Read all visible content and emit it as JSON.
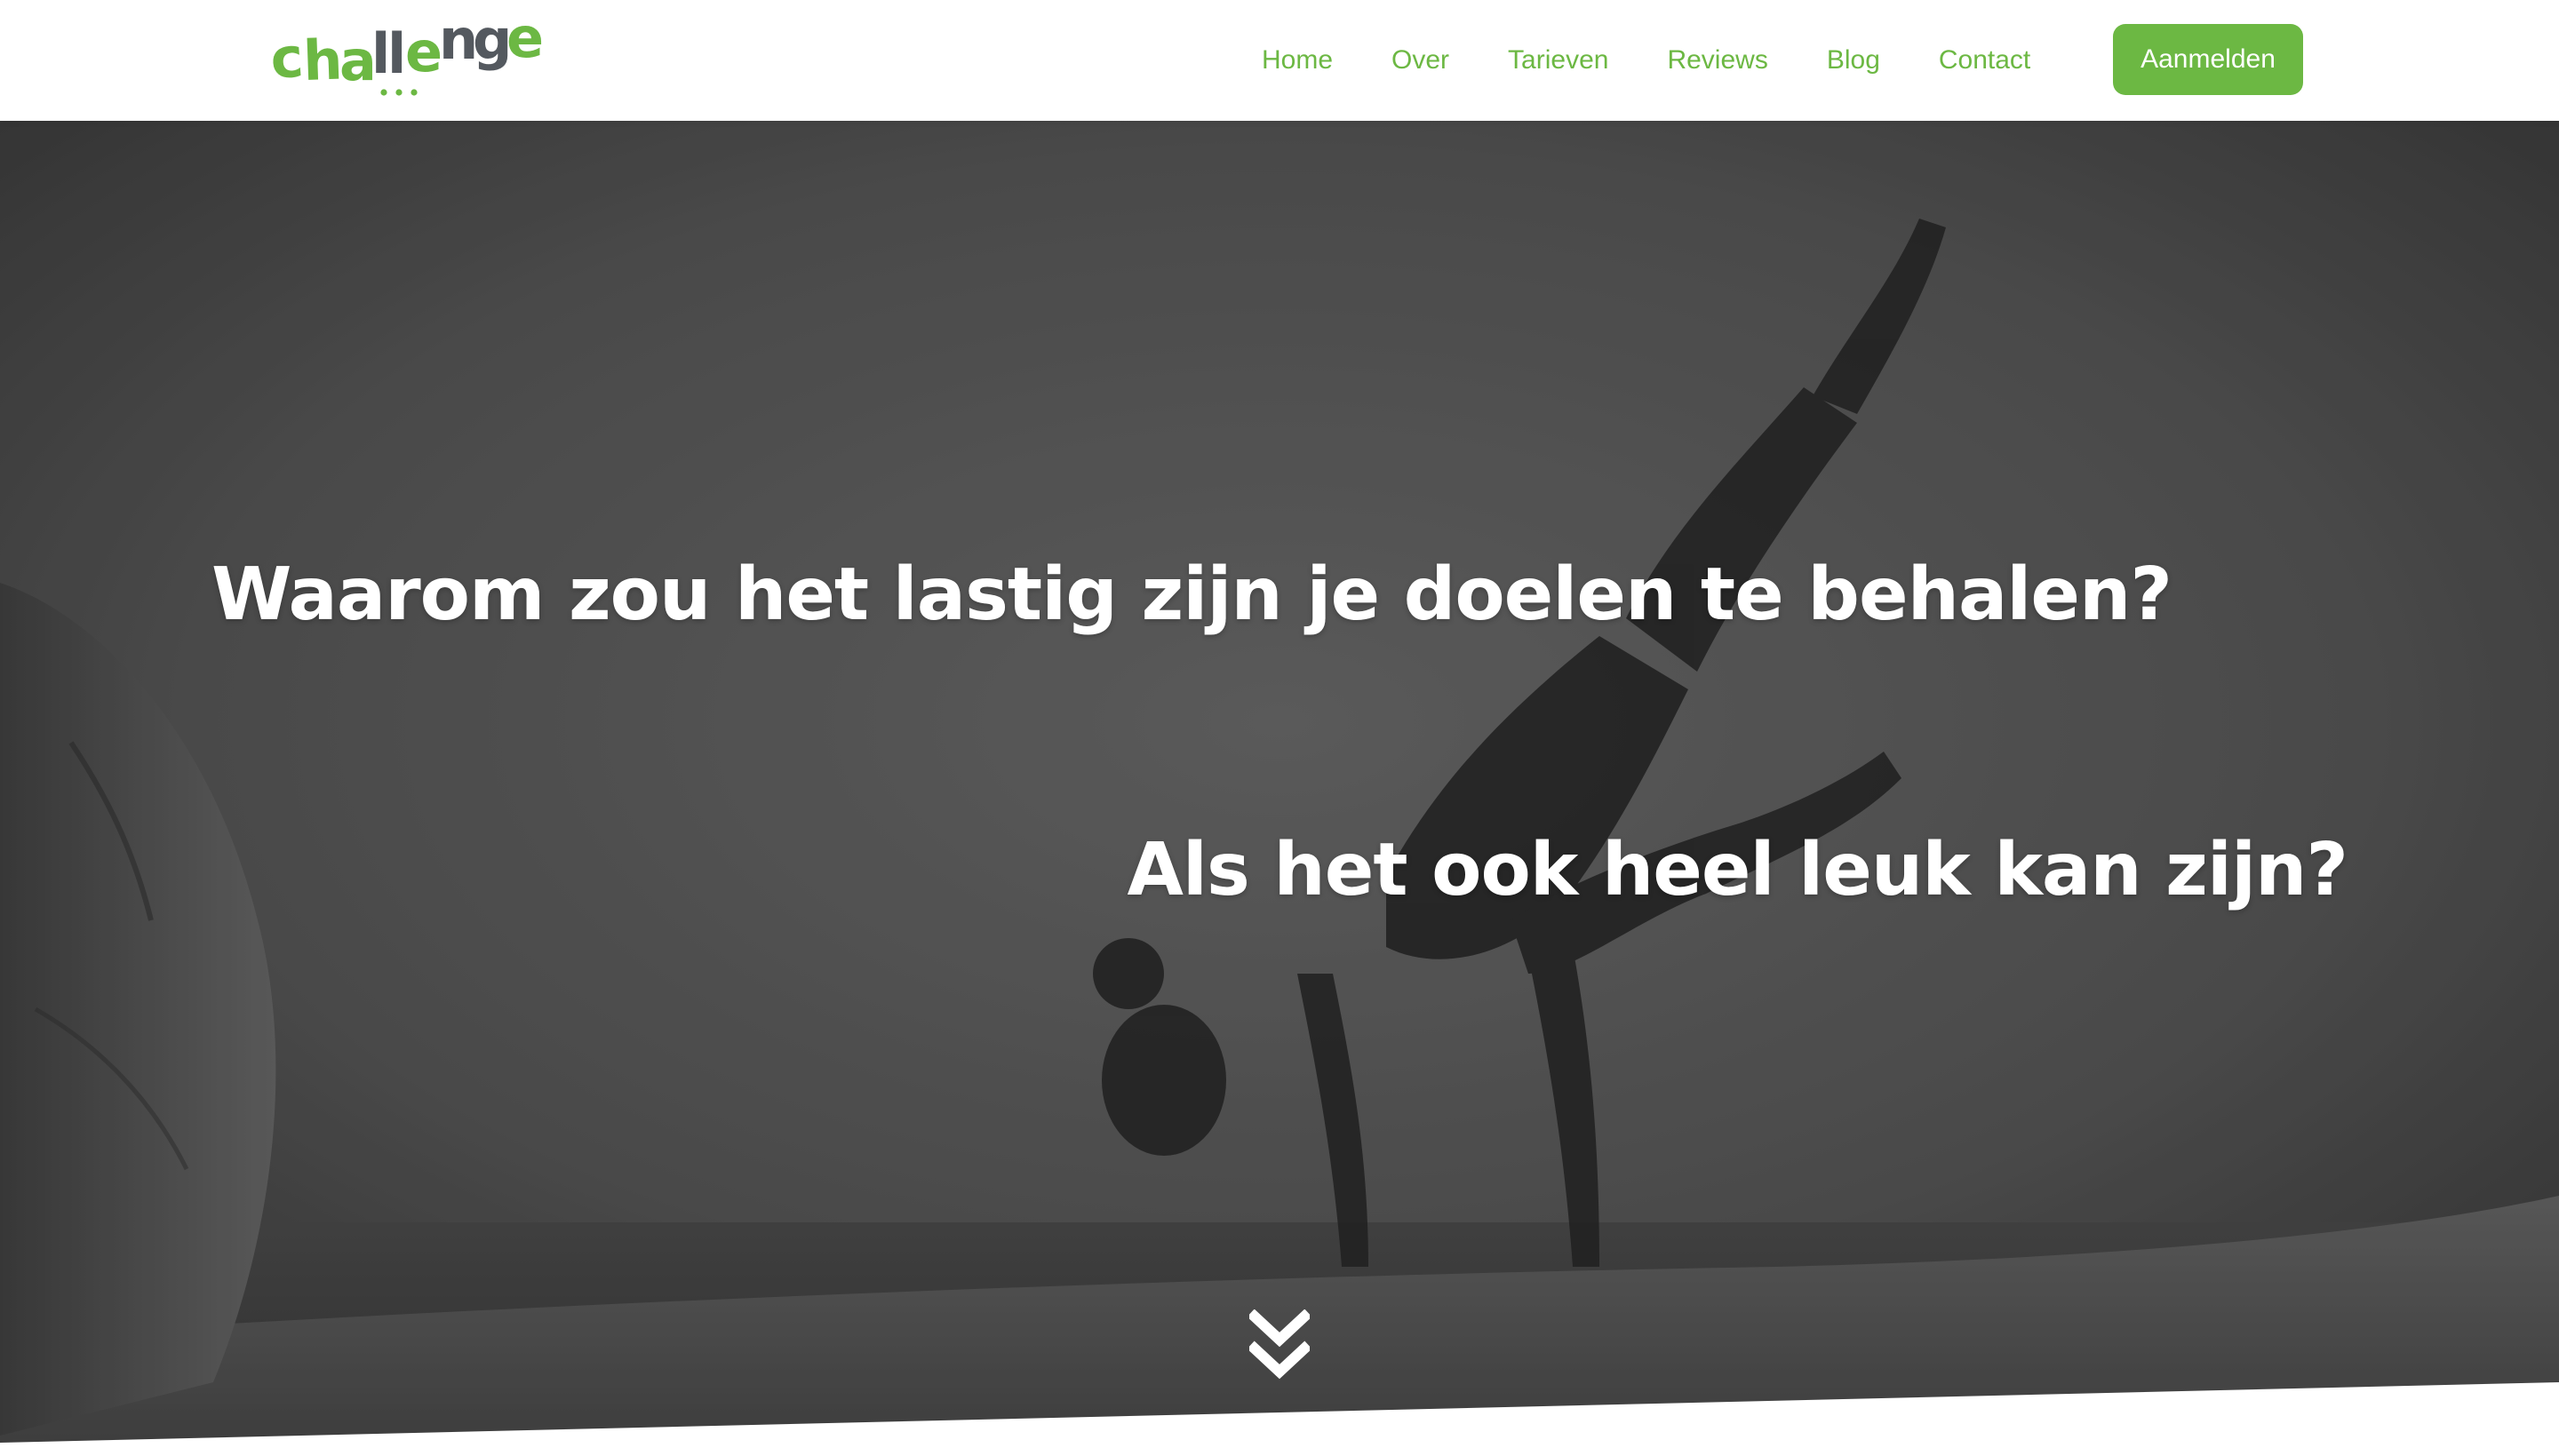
{
  "brand": {
    "logo_text_green": "cha",
    "logo_text_grey": "ll",
    "logo_text_green2": "e",
    "logo_text_grey2": "nge",
    "logo_dots": "...",
    "accent_color": "#6cb843",
    "grey_color": "#54595f"
  },
  "nav": {
    "items": [
      {
        "label": "Home"
      },
      {
        "label": "Over"
      },
      {
        "label": "Tarieven"
      },
      {
        "label": "Reviews"
      },
      {
        "label": "Blog"
      },
      {
        "label": "Contact"
      }
    ],
    "cta_label": "Aanmelden"
  },
  "hero": {
    "heading_1": "Waarom zou het lastig zijn je doelen te behalen?",
    "heading_2": "Als het ook heel leuk kan zijn?",
    "scroll_icon": "double-chevron-down-icon",
    "image_description_icon": "yoga-photo"
  }
}
